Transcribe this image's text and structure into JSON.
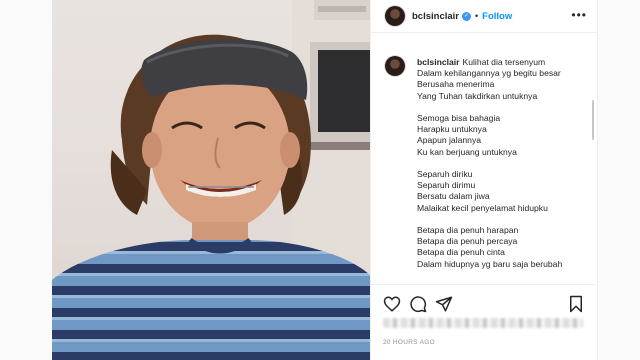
{
  "post": {
    "username": "bclsinclair",
    "separator": "•",
    "follow_label": "Follow",
    "more_label": "•••",
    "verified_mark": "✓",
    "caption_lines": [
      "Kulihat dia tersenyum",
      "Dalam kehilangannya yg begitu besar",
      "Berusaha menerima",
      "Yang Tuhan takdirkan untuknya",
      "",
      "Semoga bisa bahagia",
      "Harapku untuknya",
      "Apapun jalannya",
      "Ku kan berjuang untuknya",
      "",
      "Separuh diriku",
      "Separuh dirimu",
      "Bersatu dalam jiwa",
      "Malaikat kecil penyelamat hidupku",
      "",
      "Betapa dia penuh harapan",
      "Betapa dia penuh percaya",
      "Betapa dia penuh cinta",
      "Dalam hidupnya yg baru saja berubah"
    ],
    "timestamp": "20 HOURS AGO"
  },
  "icons": {
    "like": "heart-icon",
    "comment": "comment-icon",
    "share": "share-icon",
    "save": "bookmark-icon",
    "verified": "verified-badge-icon",
    "more": "more-options-icon"
  },
  "colors": {
    "accent": "#0095f6",
    "verified": "#3897f0",
    "text": "#262626",
    "muted": "#8e8e8e"
  }
}
